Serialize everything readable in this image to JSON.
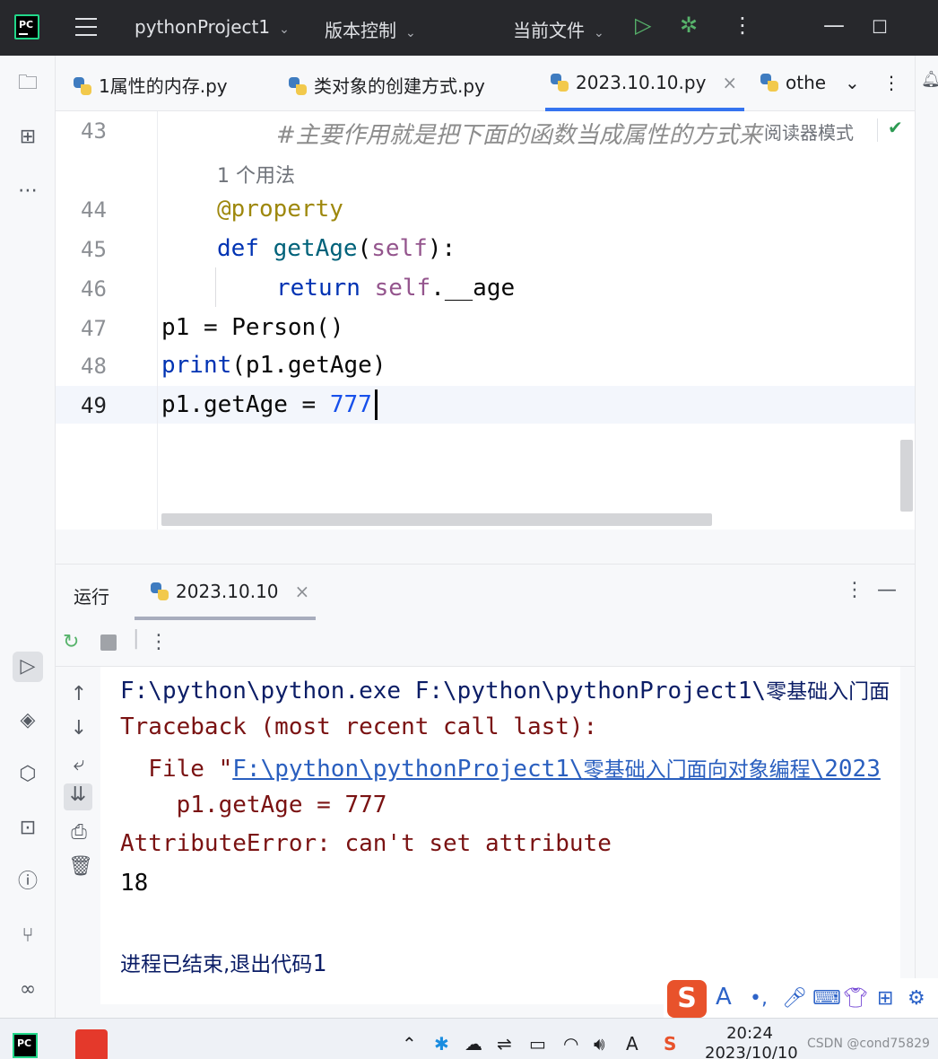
{
  "titlebar": {
    "project": "pythonProject1",
    "vcs": "版本控制",
    "run_config": "当前文件"
  },
  "tabs": [
    {
      "label": "1属性的内存.py"
    },
    {
      "label": "类对象的创建方式.py"
    },
    {
      "label": "2023.10.10.py",
      "active": true
    },
    {
      "label": "othe"
    }
  ],
  "editor": {
    "reader_mode": "阅读器模式",
    "usage_hint": "1 个用法",
    "lines": [
      {
        "num": "43",
        "comment": "#主要作用就是把下面的函数当成属性的方式来"
      },
      {
        "num": "44",
        "decorator": "@property"
      },
      {
        "num": "45",
        "kw": "def",
        "fn": "getAge",
        "open": "(",
        "self": "self",
        "close": "):"
      },
      {
        "num": "46",
        "kw": "return",
        "self": "self",
        "rest": ".__age"
      },
      {
        "num": "47",
        "text": "p1 = Person()"
      },
      {
        "num": "48",
        "kw": "print",
        "rest": "(p1.getAge)"
      },
      {
        "num": "49",
        "text": "p1.getAge = ",
        "number": "777"
      }
    ]
  },
  "run_panel": {
    "title": "运行",
    "tab": "2023.10.10",
    "console": {
      "line1_a": "F:\\python\\python.exe F:\\python\\pythonProject1\\",
      "line1_b": "零基础入门面",
      "line2": "Traceback (most recent call last):",
      "line3_a": "  File \"",
      "line3_link_a": "F:\\python\\pythonProject1\\",
      "line3_link_b": "零基础入门面向对象编程",
      "line3_link_c": "\\2023",
      "line4": "    p1.getAge = 777",
      "line5": "AttributeError: can't set attribute",
      "line6": "18",
      "line7_a": "进程已结束,退出代码",
      "line7_b": "1"
    }
  },
  "taskbar": {
    "time": "20:24",
    "date": "2023/10/10",
    "watermark": "CSDN @cond75829"
  },
  "colors": {
    "titlebar_bg": "#27282c",
    "accent": "#3574f0",
    "keyword": "#0033b3",
    "error": "#7a1212"
  }
}
